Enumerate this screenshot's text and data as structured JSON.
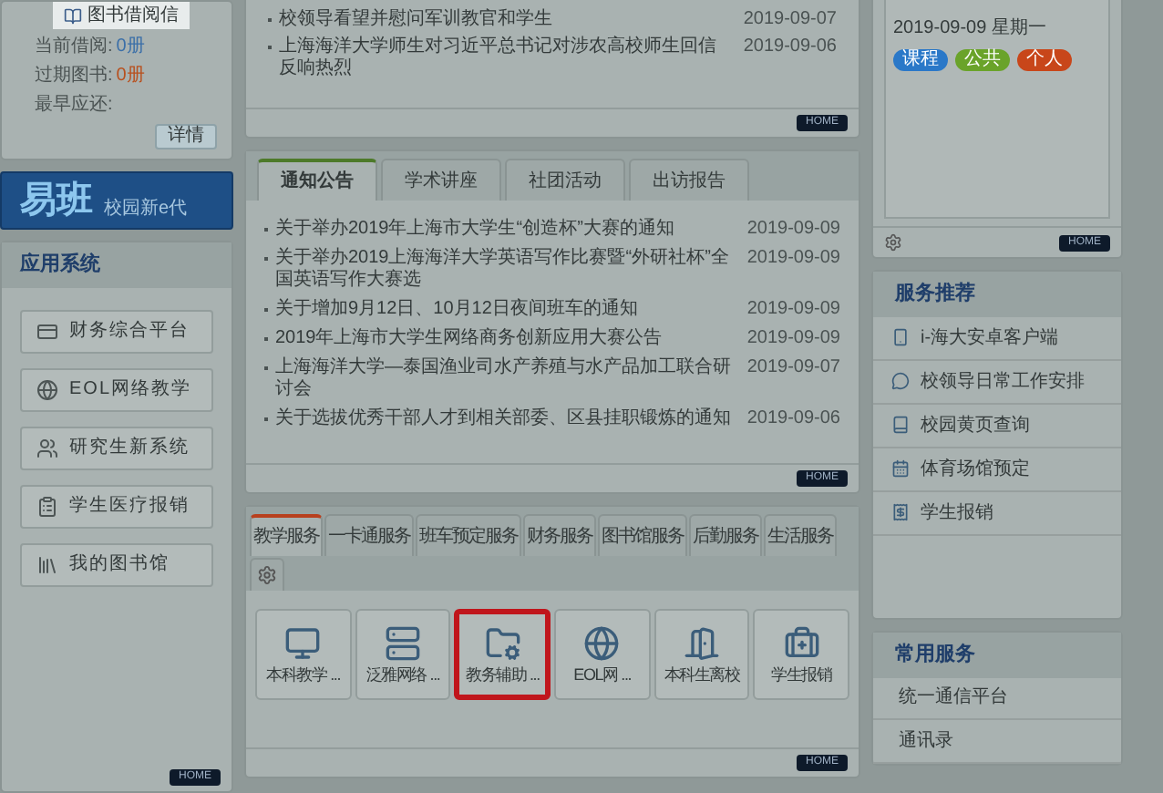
{
  "library": {
    "tab": "图书借阅信",
    "fields": [
      {
        "label": "当前借阅:",
        "value": "0册",
        "kind": "current"
      },
      {
        "label": "过期图书:",
        "value": "0册",
        "kind": "overdue"
      },
      {
        "label": "最早应还:"
      }
    ],
    "button": "详情"
  },
  "banner": {
    "logo": "易班",
    "slogan": "校园新e代"
  },
  "app_system": {
    "title": "应用系统",
    "items": [
      "财务综合平台",
      "EOL网络教学",
      "研究生新系统",
      "学生医疗报销",
      "我的图书馆"
    ],
    "footer_button": "HOME"
  },
  "news": {
    "items": [
      {
        "title": "校领导看望并慰问军训教官和学生",
        "date": "2019-09-07"
      },
      {
        "title": "上海海洋大学师生对习近平总书记对涉农高校师生回信反响热烈",
        "date": "2019-09-06"
      }
    ],
    "footer_button": "HOME"
  },
  "notices": {
    "tabs": [
      {
        "label": "通知公告",
        "selected": true
      },
      {
        "label": "学术讲座",
        "selected": false
      },
      {
        "label": "社团活动",
        "selected": false
      },
      {
        "label": "出访报告",
        "selected": false
      }
    ],
    "items": [
      {
        "title": "关于举办2019年上海市大学生“创造杯”大赛的通知",
        "date": "2019-09-09"
      },
      {
        "title": "关于举办2019上海海洋大学英语写作比赛暨“外研社杯”全国英语写作大赛选",
        "date": "2019-09-09"
      },
      {
        "title": "关于增加9月12日、10月12日夜间班车的通知",
        "date": "2019-09-09"
      },
      {
        "title": "2019年上海市大学生网络商务创新应用大赛公告",
        "date": "2019-09-09"
      },
      {
        "title": "上海海洋大学—泰国渔业司水产养殖与水产品加工联合研讨会",
        "date": "2019-09-07"
      },
      {
        "title": "关于选拔优秀干部人才到相关部委、区县挂职锻炼的通知",
        "date": "2019-09-06"
      }
    ],
    "footer_button": "HOME"
  },
  "services": {
    "tabs": [
      {
        "label": "教学服务",
        "selected": true
      },
      {
        "label": "一卡通服务",
        "selected": false
      },
      {
        "label": "班车预定服务",
        "selected": false
      },
      {
        "label": "财务服务",
        "selected": false
      },
      {
        "label": "图书馆服务",
        "selected": false
      },
      {
        "label": "后勤服务",
        "selected": false
      },
      {
        "label": "生活服务",
        "selected": false
      }
    ],
    "apps": [
      {
        "label": "本科教学 ...",
        "highlighted": false
      },
      {
        "label": "泛雅网络 ...",
        "highlighted": false
      },
      {
        "label": "教务辅助 ...",
        "highlighted": true
      },
      {
        "label": "EOL网 ...",
        "highlighted": false
      },
      {
        "label": "本科生离校",
        "highlighted": false
      },
      {
        "label": "学生报销",
        "highlighted": false
      }
    ],
    "footer_button": "HOME"
  },
  "calendar": {
    "date": "2019-09-09 星期一",
    "tags": [
      {
        "label": "课程",
        "color": "#2a78c8"
      },
      {
        "label": "公共",
        "color": "#6aa32a"
      },
      {
        "label": "个人",
        "color": "#c8461a"
      }
    ],
    "footer_button": "HOME"
  },
  "recommended": {
    "title": "服务推荐",
    "items": [
      "i-海大安卓客户端",
      "校领导日常工作安排",
      "校园黄页查询",
      "体育场馆预定",
      "学生报销"
    ]
  },
  "common": {
    "title": "常用服务",
    "items": [
      "统一通信平台",
      "通讯录"
    ]
  }
}
